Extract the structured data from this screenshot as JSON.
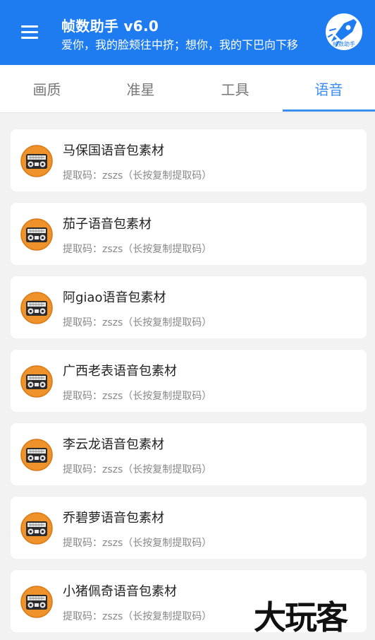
{
  "header": {
    "title": "帧数助手 v6.0",
    "subtitle": "爱你，我的脸颊往中挤；想你，我的下巴向下移",
    "logo_text": "帧数助手",
    "menu_icon": "menu-icon",
    "background": "#1e7cf0"
  },
  "tabs": [
    {
      "label": "画质",
      "active": false
    },
    {
      "label": "准星",
      "active": false
    },
    {
      "label": "工具",
      "active": false
    },
    {
      "label": "语音",
      "active": true
    }
  ],
  "accent_color": "#3a8ef2",
  "voice_packs": [
    {
      "title": "马保国语音包素材",
      "subtitle": "提取码：zszs（长按复制提取码）",
      "icon": "radio-icon"
    },
    {
      "title": "茄子语音包素材",
      "subtitle": "提取码：zszs（长按复制提取码）",
      "icon": "radio-icon"
    },
    {
      "title": "阿giao语音包素材",
      "subtitle": "提取码：zszs（长按复制提取码）",
      "icon": "radio-icon"
    },
    {
      "title": "广西老表语音包素材",
      "subtitle": "提取码：zszs（长按复制提取码）",
      "icon": "radio-icon"
    },
    {
      "title": "李云龙语音包素材",
      "subtitle": "提取码：zszs（长按复制提取码）",
      "icon": "radio-icon"
    },
    {
      "title": "乔碧萝语音包素材",
      "subtitle": "提取码：zszs（长按复制提取码）",
      "icon": "radio-icon"
    },
    {
      "title": "小猪佩奇语音包素材",
      "subtitle": "提取码：zszs（长按复制提取码）",
      "icon": "radio-icon"
    }
  ],
  "watermark": "大玩客"
}
